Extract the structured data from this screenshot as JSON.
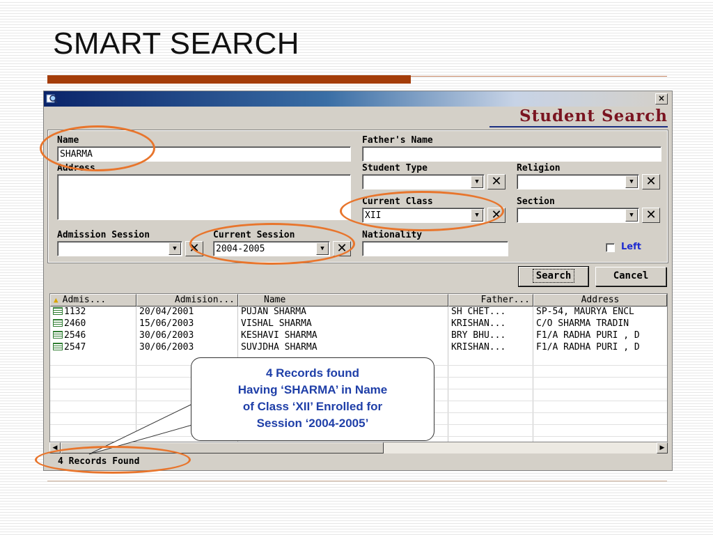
{
  "slide": {
    "title": "SMART SEARCH"
  },
  "window": {
    "close_glyph": "×",
    "header_title": "Student Search"
  },
  "form": {
    "name_label": "Name",
    "name_value": "SHARMA",
    "father_label": "Father's Name",
    "father_value": "",
    "address_label": "Address",
    "address_value": "",
    "student_type_label": "Student Type",
    "student_type_value": "",
    "religion_label": "Religion",
    "religion_value": "",
    "current_class_label": "Current Class",
    "current_class_value": "XII",
    "section_label": "Section",
    "section_value": "",
    "admission_session_label": "Admission Session",
    "admission_session_value": "",
    "current_session_label": "Current Session",
    "current_session_value": "2004-2005",
    "nationality_label": "Nationality",
    "nationality_value": "",
    "left_label": "Left",
    "left_checked": false
  },
  "buttons": {
    "search": "Search",
    "cancel": "Cancel"
  },
  "grid": {
    "columns": [
      "Admis...",
      "Admision...",
      "Name",
      "Father...",
      "Address"
    ],
    "rows": [
      [
        "1132",
        "20/04/2001",
        "PUJAN SHARMA",
        "SH CHET...",
        "SP-54, MAURYA ENCL"
      ],
      [
        "2460",
        "15/06/2003",
        "VISHAL SHARMA",
        "KRISHAN...",
        "C/O SHARMA TRADIN"
      ],
      [
        "2546",
        "30/06/2003",
        "KESHAVI SHARMA",
        "BRY BHU...",
        "F1/A RADHA PURI , D"
      ],
      [
        "2547",
        "30/06/2003",
        "SUVJDHA SHARMA",
        "KRISHAN...",
        "F1/A RADHA PURI , D"
      ]
    ]
  },
  "status": {
    "text": "4 Records Found"
  },
  "callout": {
    "line1": "4 Records found",
    "line2": "Having ‘SHARMA’ in Name",
    "line3": "of Class ‘XII’ Enrolled for",
    "line4": "Session ‘2004-2005’"
  },
  "colors": {
    "highlight": "#e8752c",
    "callout_text": "#1f3fa8",
    "header_title": "#7a1420",
    "title_rule": "#a43d0a"
  }
}
